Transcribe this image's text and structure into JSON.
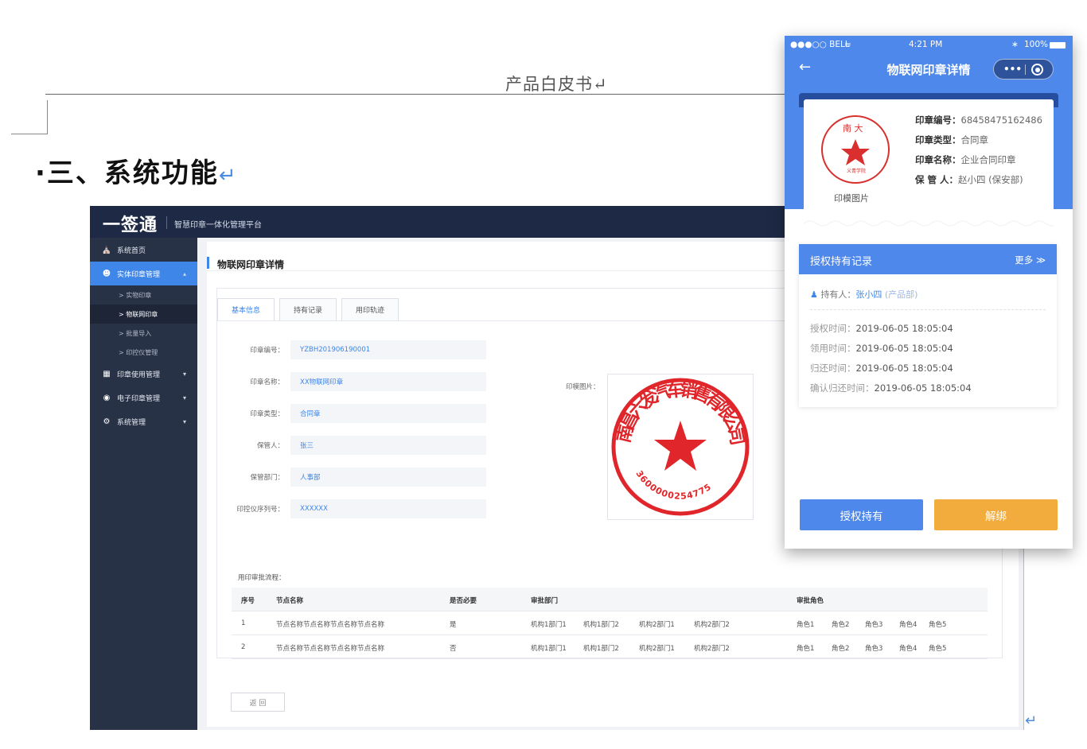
{
  "document": {
    "header": "产品白皮书↵",
    "section_title": "·三、系统功能",
    "return_mark": "↵"
  },
  "app": {
    "logo": "一签通",
    "platform_name": "智慧印章一体化管理平台",
    "sidebar": {
      "items": [
        {
          "label": "系统首页",
          "icon": "home-icon"
        },
        {
          "label": "实体印章管理",
          "icon": "user-icon"
        },
        {
          "label": "印章使用管理",
          "icon": "calendar-icon"
        },
        {
          "label": "电子印章管理",
          "icon": "target-icon"
        },
        {
          "label": "系统管理",
          "icon": "gear-icon"
        }
      ],
      "subitems": [
        "> 实物印章",
        "> 物联网印章",
        "> 批量导入",
        "> 印控仪管理"
      ]
    },
    "page_title": "物联网印章详情",
    "tabs": [
      "基本信息",
      "持有记录",
      "用印轨迹"
    ],
    "fields": [
      {
        "label": "印章编号：",
        "value": "YZBH201906190001"
      },
      {
        "label": "印章名称：",
        "value": "XX物联网印章"
      },
      {
        "label": "印章类型：",
        "value": "合同章"
      },
      {
        "label": "保管人：",
        "value": "张三"
      },
      {
        "label": "保管部门：",
        "value": "人事部"
      },
      {
        "label": "印控仪序列号：",
        "value": "XXXXXX"
      }
    ],
    "image_label": "印模图片：",
    "seal": {
      "text": "南昌六发汽车销售有限公司",
      "number": "3600000254775",
      "color": "#e0262a"
    },
    "flow_label": "用印审批流程：",
    "table": {
      "headers": [
        "序号",
        "节点名称",
        "是否必要",
        "审批部门",
        "审批角色"
      ],
      "rows": [
        {
          "no": "1",
          "name": "节点名称节点名称节点名称节点名称",
          "required": "是",
          "depts": [
            "机构1部门1",
            "机构1部门2",
            "机构2部门1",
            "机构2部门2"
          ],
          "roles": [
            "角色1",
            "角色2",
            "角色3",
            "角色4",
            "角色5"
          ]
        },
        {
          "no": "2",
          "name": "节点名称节点名称节点名称节点名称",
          "required": "否",
          "depts": [
            "机构1部门1",
            "机构1部门2",
            "机构2部门1",
            "机构2部门2"
          ],
          "roles": [
            "角色1",
            "角色2",
            "角色3",
            "角色4",
            "角色5"
          ]
        }
      ]
    },
    "back_button": "返 回"
  },
  "mobile": {
    "status": {
      "carrier": "●●●○○ BELL",
      "wifi": "wifi-icon",
      "time": "4:21 PM",
      "battery": "100%"
    },
    "back_icon": "←",
    "title": "物联网印章详情",
    "capsule": {
      "menu": "•••"
    },
    "seal_caption": "印模图片",
    "seal_text": {
      "top": "南  大",
      "mid": "义青学院"
    },
    "info": [
      {
        "label": "印章编号：",
        "value": "68458475162486"
      },
      {
        "label": "印章类型：",
        "value": "合同章"
      },
      {
        "label": "印章名称：",
        "value": "企业合同印章"
      },
      {
        "label": "保 管 人：",
        "value": "赵小四 (保安部)"
      }
    ],
    "record": {
      "title": "授权持有记录",
      "more": "更多 ≫",
      "holder_label": "持有人：",
      "holder_name": "张小四",
      "holder_dept": "(产品部)",
      "lines": [
        {
          "label": "授权时间：",
          "value": "2019-06-05  18:05:04"
        },
        {
          "label": "领用时间：",
          "value": "2019-06-05  18:05:04"
        },
        {
          "label": "归还时间：",
          "value": "2019-06-05  18:05:04"
        },
        {
          "label": "确认归还时间：",
          "value": "2019-06-05  18:05:04"
        }
      ]
    },
    "buttons": {
      "authorize": "授权持有",
      "unbind": "解绑"
    },
    "colors": {
      "primary": "#4e88ea",
      "accent": "#f2ac3e"
    }
  }
}
